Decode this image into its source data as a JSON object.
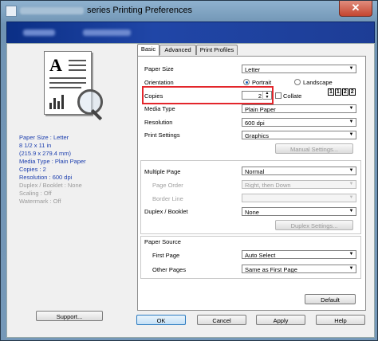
{
  "window": {
    "title": "series Printing Preferences",
    "close_glyph": "✕"
  },
  "summary": {
    "paper_size": "Paper Size : Letter",
    "paper_dims_in": "8 1/2 x 11 in",
    "paper_dims_mm": "(215.9 x 279.4 mm)",
    "media_type": "Media Type : Plain Paper",
    "copies": "Copies : 2",
    "resolution": "Resolution : 600 dpi",
    "duplex": "Duplex / Booklet : None",
    "scaling": "Scaling : Off",
    "watermark": "Watermark : Off"
  },
  "buttons": {
    "support": "Support...",
    "ok": "OK",
    "cancel": "Cancel",
    "apply": "Apply",
    "help": "Help",
    "manual_settings": "Manual Settings...",
    "duplex_settings": "Duplex Settings...",
    "default": "Default"
  },
  "tabs": [
    "Basic",
    "Advanced",
    "Print Profiles"
  ],
  "form": {
    "paper_size": {
      "label": "Paper Size",
      "value": "Letter"
    },
    "orientation": {
      "label": "Orientation",
      "portrait": "Portrait",
      "landscape": "Landscape"
    },
    "copies": {
      "label": "Copies",
      "value": "2",
      "collate": "Collate"
    },
    "media_type": {
      "label": "Media Type",
      "value": "Plain Paper"
    },
    "resolution": {
      "label": "Resolution",
      "value": "600 dpi"
    },
    "print_settings": {
      "label": "Print Settings",
      "value": "Graphics"
    },
    "multiple_page": {
      "label": "Multiple Page",
      "value": "Normal"
    },
    "page_order": {
      "label": "Page Order",
      "value": "Right, then Down"
    },
    "border_line": {
      "label": "Border Line",
      "value": ""
    },
    "duplex_booklet": {
      "label": "Duplex / Booklet",
      "value": "None"
    },
    "paper_source": {
      "label": "Paper Source"
    },
    "first_page": {
      "label": "First Page",
      "value": "Auto Select"
    },
    "other_pages": {
      "label": "Other Pages",
      "value": "Same as First Page"
    }
  },
  "preview": {
    "letter": "A"
  },
  "colors": {
    "highlight": "#e3262b",
    "summary_text": "#1d3fae",
    "header_band": "#0b2f86"
  }
}
